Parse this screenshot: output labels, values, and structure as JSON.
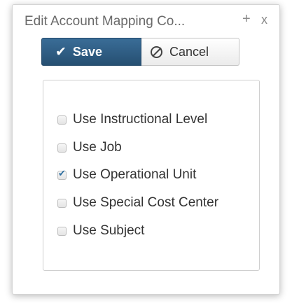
{
  "dialog": {
    "title": "Edit Account Mapping Co...",
    "plus_icon": "+",
    "close_icon": "x"
  },
  "toolbar": {
    "save_icon": "✔",
    "save_label": "Save",
    "cancel_label": "Cancel"
  },
  "options": [
    {
      "label": "Use Instructional Level",
      "checked": false
    },
    {
      "label": "Use Job",
      "checked": false
    },
    {
      "label": "Use Operational Unit",
      "checked": true
    },
    {
      "label": "Use Special Cost Center",
      "checked": false
    },
    {
      "label": "Use Subject",
      "checked": false
    }
  ],
  "colors": {
    "primary_button": "#2f5f86",
    "check_accent": "#2f6fa0"
  },
  "icons": {
    "save": "checkmark-icon",
    "cancel": "cancel-icon",
    "plus": "plus-icon",
    "close": "close-icon",
    "checkbox": "checkbox-icon"
  }
}
